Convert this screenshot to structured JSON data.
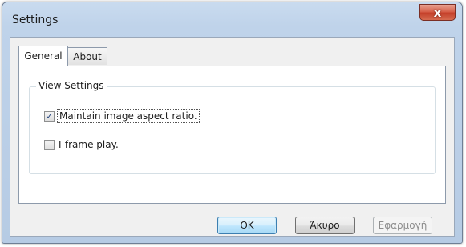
{
  "window": {
    "title": "Settings",
    "close_glyph": "x"
  },
  "tabs": [
    {
      "label": "General",
      "selected": true
    },
    {
      "label": "About",
      "selected": false
    }
  ],
  "view_settings": {
    "group_label": "View Settings",
    "options": [
      {
        "label": "Maintain image aspect ratio.",
        "checked": true,
        "focused": true
      },
      {
        "label": "I-frame play.",
        "checked": false,
        "focused": false
      }
    ]
  },
  "buttons": {
    "ok": "OK",
    "cancel": "Άκυρο",
    "apply": "Εφαρμογή"
  },
  "colors": {
    "titlebar": "#bfd3ea",
    "close_button": "#c4402a",
    "default_button_border": "#3c7fb1"
  },
  "icons": {
    "check": "✓"
  }
}
